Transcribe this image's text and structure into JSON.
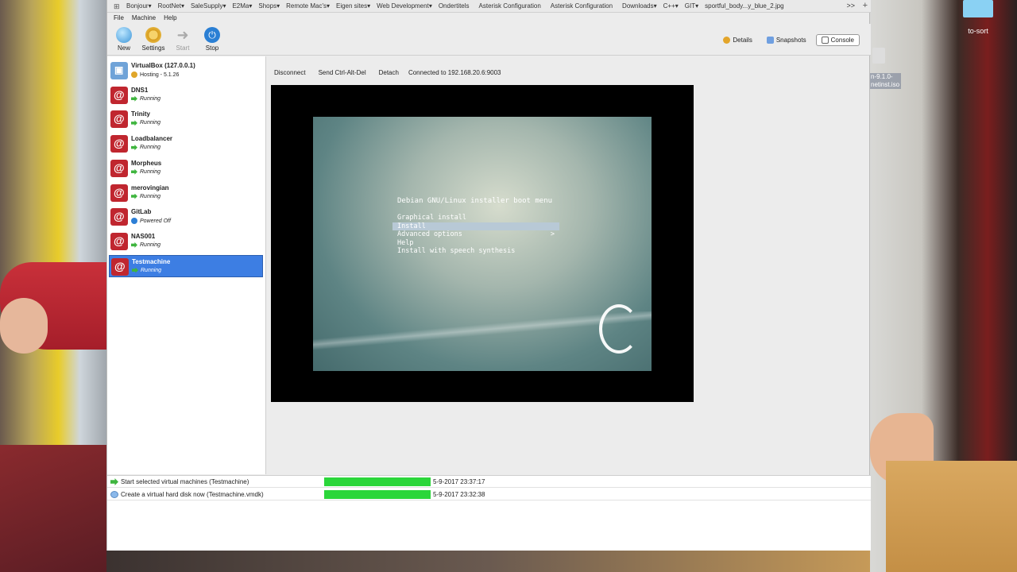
{
  "desktop": {
    "folder_label": "to-sort",
    "iso_label": "n-9.1.0-\nnetinst.iso"
  },
  "bookmarks": [
    "Bonjour",
    "RootNet",
    "SaleSupply",
    "E2Ma",
    "Shops",
    "Remote Mac's",
    "Eigen sites",
    "Web Development",
    "Ondertitels",
    "Asterisk Configuration",
    "Asterisk Configuration",
    "Downloads",
    "C++",
    "GIT",
    "sportful_body...y_blue_2.jpg"
  ],
  "bookmarks_more": ">>",
  "menu": [
    "File",
    "Machine",
    "Help"
  ],
  "toolbar": {
    "new": "New",
    "settings": "Settings",
    "start": "Start",
    "stop": "Stop",
    "details": "Details",
    "snapshots": "Snapshots",
    "console": "Console"
  },
  "vms": [
    {
      "name": "VirtualBox (127.0.0.1)",
      "status": "Hosting - 5.1.26",
      "state": "host"
    },
    {
      "name": "DNS1",
      "status": "Running",
      "state": "running"
    },
    {
      "name": "Trinity",
      "status": "Running",
      "state": "running"
    },
    {
      "name": "Loadbalancer",
      "status": "Running",
      "state": "running"
    },
    {
      "name": "Morpheus",
      "status": "Running",
      "state": "running"
    },
    {
      "name": "merovingian",
      "status": "Running",
      "state": "running"
    },
    {
      "name": "GitLab",
      "status": "Powered Off",
      "state": "off"
    },
    {
      "name": "NAS001",
      "status": "Running",
      "state": "running"
    },
    {
      "name": "Testmachine",
      "status": "Running",
      "state": "running",
      "selected": true
    }
  ],
  "console": {
    "disconnect": "Disconnect",
    "send_cad": "Send Ctrl-Alt-Del",
    "detach": "Detach",
    "connected": "Connected to 192.168.20.6:9003"
  },
  "boot_menu": {
    "title": "Debian GNU/Linux installer boot menu",
    "options": [
      {
        "label": "Graphical install"
      },
      {
        "label": "Install",
        "selected": true
      },
      {
        "label": "Advanced options",
        "arrow": ">"
      },
      {
        "label": "Help"
      },
      {
        "label": "Install with speech synthesis"
      }
    ]
  },
  "tasks": [
    {
      "label": "Start selected virtual machines (Testmachine)",
      "progress": 1.0,
      "time": "5-9-2017 23:37:17",
      "icon": "start"
    },
    {
      "label": "Create a virtual hard disk now (Testmachine.vmdk)",
      "progress": 1.0,
      "time": "5-9-2017 23:32:38",
      "icon": "disk"
    }
  ]
}
